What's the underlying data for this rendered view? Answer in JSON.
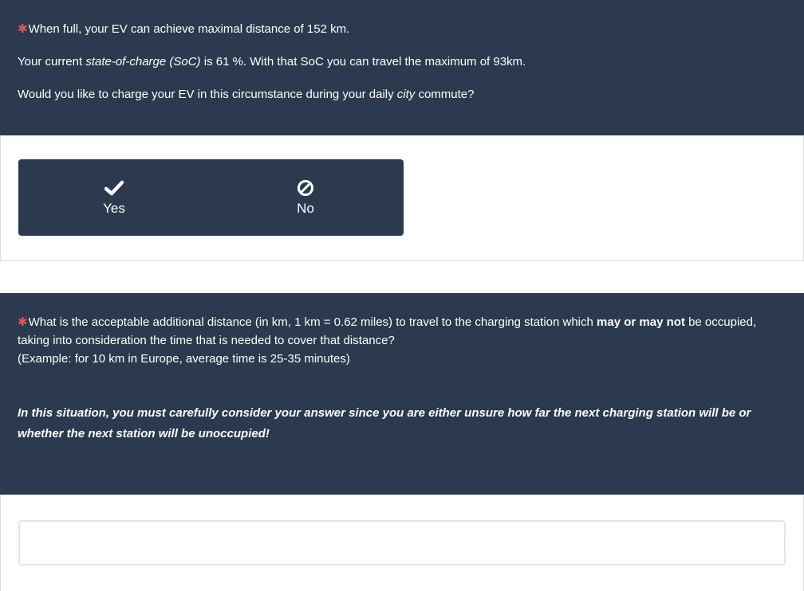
{
  "question1": {
    "required_mark": "✱",
    "line1": "When full, your EV can achieve maximal distance of 152 km.",
    "line2_a": "Your current ",
    "line2_em": "state-of-charge (SoC)",
    "line2_b": " is 61 %. With that SoC you can travel the maximum of 93km.",
    "line3_a": "Would you like to charge your EV in this circumstance during your daily ",
    "line3_em": "city",
    "line3_b": " commute?",
    "options": [
      {
        "label": "Yes",
        "icon": "check-icon"
      },
      {
        "label": "No",
        "icon": "ban-icon"
      }
    ]
  },
  "question2": {
    "required_mark": "✱",
    "line1_a": "What is the acceptable additional distance (in km, 1 km = 0.62 miles) to travel to the charging station which ",
    "line1_bold": "may or may not",
    "line1_b": " be occupied, taking into consideration the time that is needed to cover that distance?",
    "line2": "(Example: for 10 km in Europe, average time is 25-35 minutes)",
    "warning": "In this situation, you must carefully consider your answer since you are either unsure how far the next charging station will be or whether the next station will be unoccupied!",
    "input_value": ""
  },
  "colors": {
    "header_bg": "#2b3a4e",
    "required": "#e0575a",
    "text_on_dark": "#ffffff"
  }
}
